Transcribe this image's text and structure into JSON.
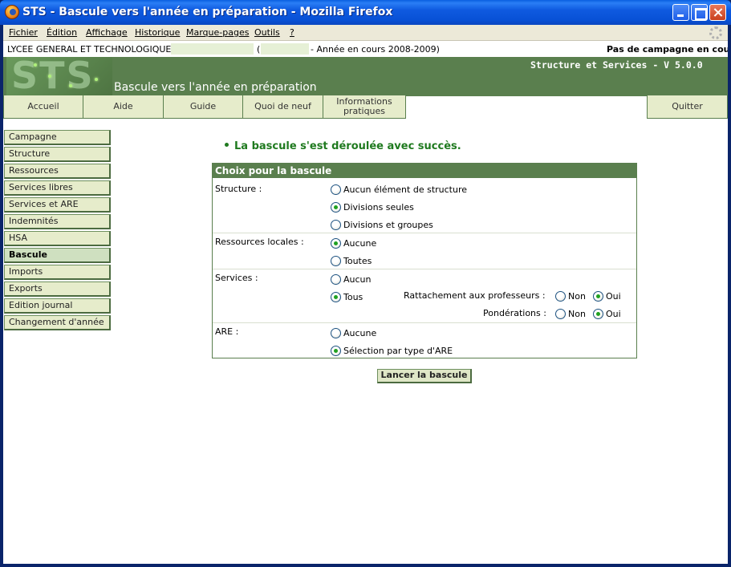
{
  "window": {
    "title": "STS - Bascule vers l'année en préparation - Mozilla Firefox"
  },
  "menubar": [
    "Fichier",
    "Édition",
    "Affichage",
    "Historique",
    "Marque-pages",
    "Outils",
    "?"
  ],
  "infobar": {
    "school": "LYCEE GENERAL ET TECHNOLOGIQUE",
    "paren_open": "(",
    "year": "- Année en cours 2008-2009)",
    "campaign": "Pas de campagne en cours"
  },
  "banner": {
    "logo_text": "STS",
    "app_name": "Structure et Services - V 5.0.0",
    "page_heading": "Bascule vers l'année en préparation"
  },
  "tabs": [
    "Accueil",
    "Aide",
    "Guide",
    "Quoi de neuf",
    "Informations pratiques"
  ],
  "quit_tab": "Quitter",
  "sidebar": [
    {
      "label": "Campagne",
      "active": false
    },
    {
      "label": "Structure",
      "active": false
    },
    {
      "label": "Ressources",
      "active": false
    },
    {
      "label": "Services libres",
      "active": false
    },
    {
      "label": "Services et ARE",
      "active": false
    },
    {
      "label": "Indemnités",
      "active": false
    },
    {
      "label": "HSA",
      "active": false
    },
    {
      "label": "Bascule",
      "active": true
    },
    {
      "label": "Imports",
      "active": false
    },
    {
      "label": "Exports",
      "active": false
    },
    {
      "label": "Edition journal",
      "active": false
    },
    {
      "label": "Changement d'année",
      "active": false
    }
  ],
  "success_message": "La bascule s'est déroulée avec succès.",
  "panel": {
    "title": "Choix pour la bascule",
    "structure": {
      "label": "Structure :",
      "options": [
        "Aucun élément de structure",
        "Divisions seules",
        "Divisions et groupes"
      ],
      "selected": 1
    },
    "ressources": {
      "label": "Ressources locales :",
      "options": [
        "Aucune",
        "Toutes"
      ],
      "selected": 0
    },
    "services": {
      "label": "Services :",
      "options": [
        "Aucun",
        "Tous"
      ],
      "selected": 1,
      "rattachement": {
        "label": "Rattachement aux professeurs :",
        "options": [
          "Non",
          "Oui"
        ],
        "selected": 1
      },
      "ponderations": {
        "label": "Pondérations :",
        "options": [
          "Non",
          "Oui"
        ],
        "selected": 1
      }
    },
    "are": {
      "label": "ARE :",
      "options": [
        "Aucune",
        "Sélection par type d'ARE"
      ],
      "selected": 1
    }
  },
  "launch_button": "Lancer la bascule",
  "colors": {
    "header_green": "#5a7f4e",
    "tab_bg": "#e6eccb",
    "success_green": "#1f7a1f"
  }
}
